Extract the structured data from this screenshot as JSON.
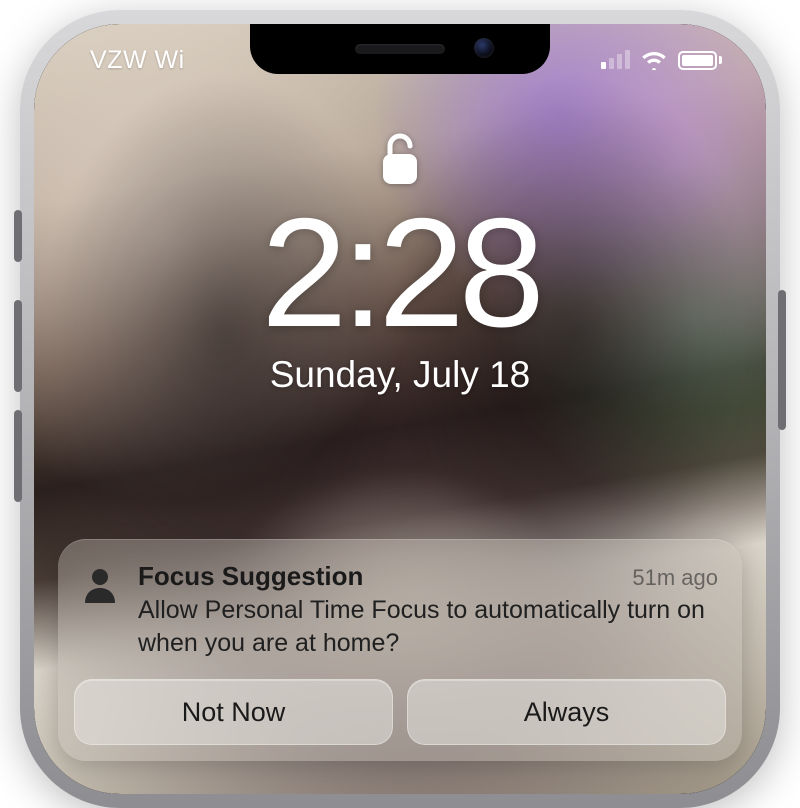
{
  "status_bar": {
    "carrier": "VZW Wi",
    "signal_strength": 1
  },
  "lock_screen": {
    "time": "2:28",
    "date": "Sunday, July 18"
  },
  "notification": {
    "title": "Focus Suggestion",
    "timestamp": "51m ago",
    "message": "Allow Personal Time Focus to automatically turn on when you are at home?",
    "actions": {
      "not_now": "Not Now",
      "always": "Always"
    }
  }
}
